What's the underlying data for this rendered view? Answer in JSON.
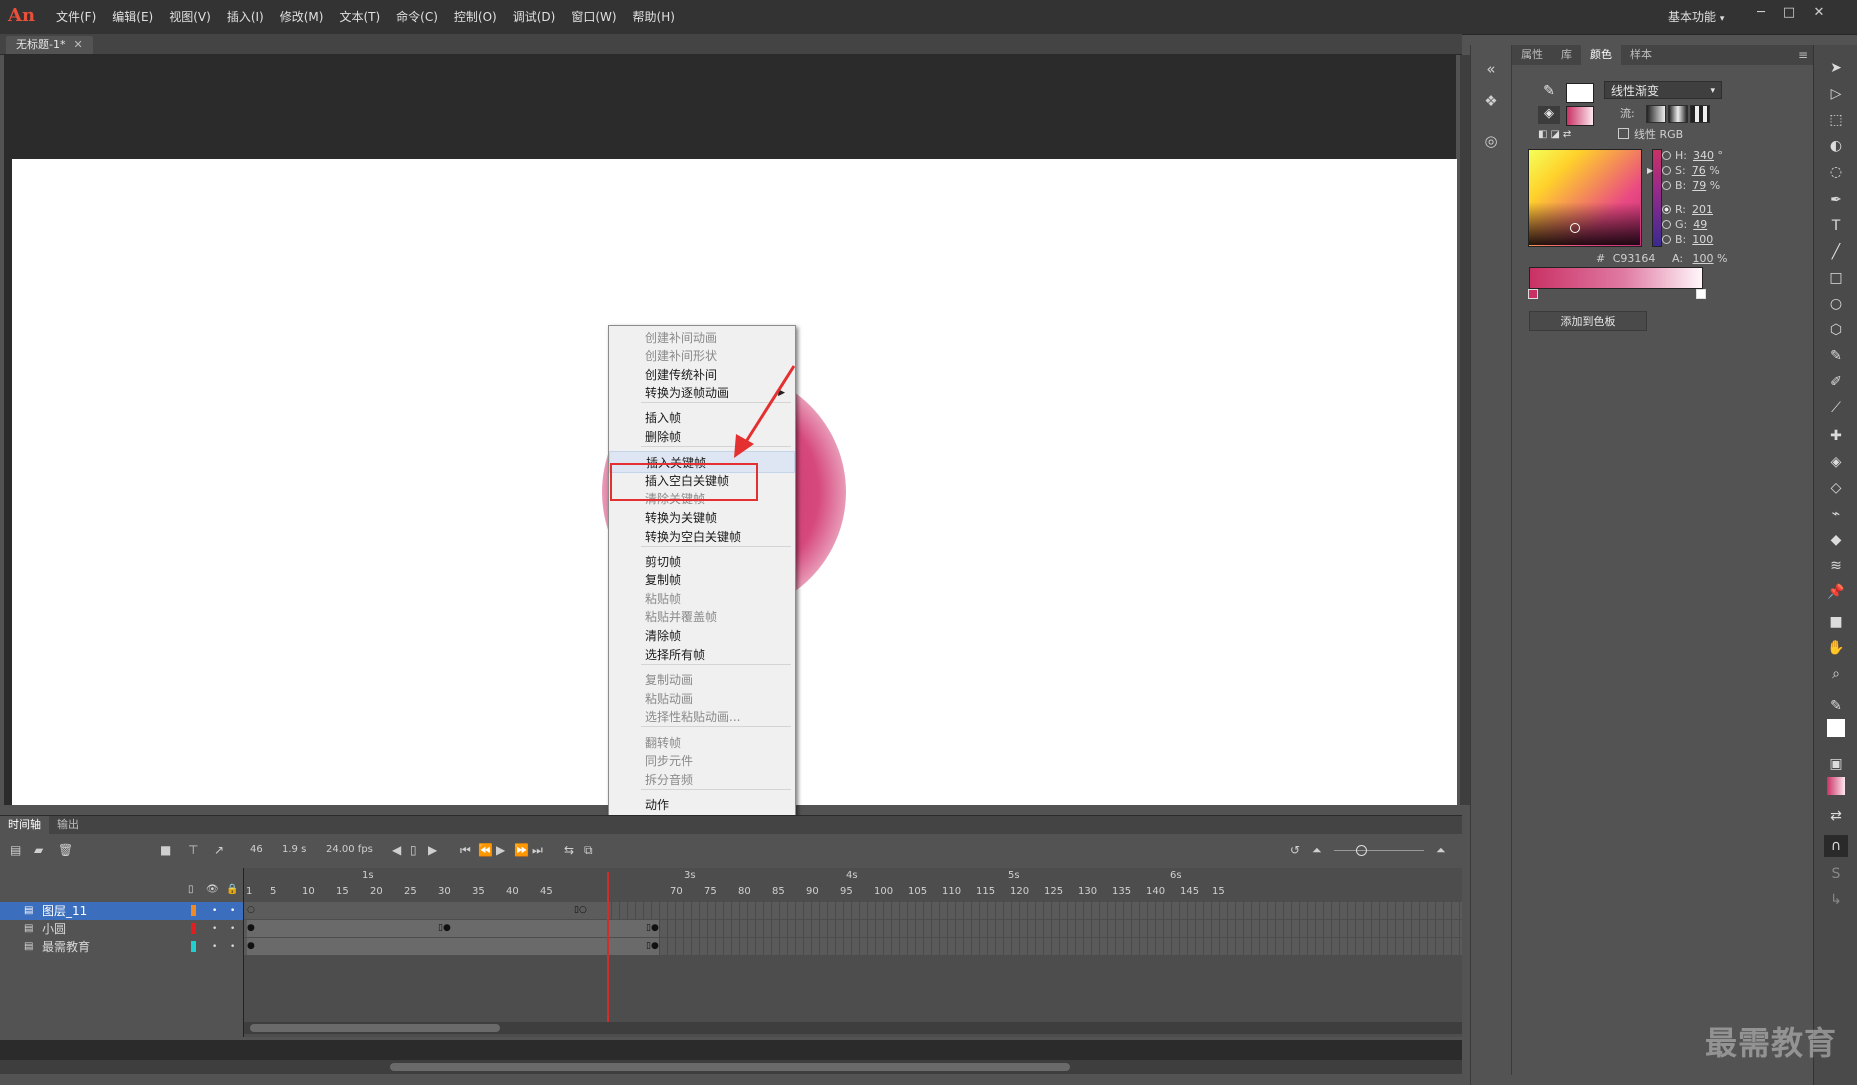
{
  "app": {
    "logo": "An",
    "workspace": "基本功能",
    "window_buttons": [
      "─",
      "□",
      "✕"
    ]
  },
  "menubar": [
    "文件(F)",
    "编辑(E)",
    "视图(V)",
    "插入(I)",
    "修改(M)",
    "文本(T)",
    "命令(C)",
    "控制(O)",
    "调试(D)",
    "窗口(W)",
    "帮助(H)"
  ],
  "document_tab": {
    "title": "无标题-1*",
    "close": "✕"
  },
  "context_menu": {
    "items": [
      {
        "label": "创建补间动画",
        "enabled": false
      },
      {
        "label": "创建补间形状",
        "enabled": false
      },
      {
        "label": "创建传统补间",
        "enabled": true
      },
      {
        "label": "转换为逐帧动画",
        "enabled": true,
        "submenu": true
      },
      {
        "label": "插入帧",
        "enabled": true
      },
      {
        "label": "删除帧",
        "enabled": true
      },
      {
        "label": "插入关键帧",
        "enabled": true,
        "highlighted": true
      },
      {
        "label": "插入空白关键帧",
        "enabled": true
      },
      {
        "label": "清除关键帧",
        "enabled": false
      },
      {
        "label": "转换为关键帧",
        "enabled": true
      },
      {
        "label": "转换为空白关键帧",
        "enabled": true
      },
      {
        "label": "剪切帧",
        "enabled": true
      },
      {
        "label": "复制帧",
        "enabled": true
      },
      {
        "label": "粘贴帧",
        "enabled": false
      },
      {
        "label": "粘贴并覆盖帧",
        "enabled": false
      },
      {
        "label": "清除帧",
        "enabled": true
      },
      {
        "label": "选择所有帧",
        "enabled": true
      },
      {
        "label": "复制动画",
        "enabled": false
      },
      {
        "label": "粘贴动画",
        "enabled": false
      },
      {
        "label": "选择性粘贴动画...",
        "enabled": false
      },
      {
        "label": "翻转帧",
        "enabled": false
      },
      {
        "label": "同步元件",
        "enabled": false
      },
      {
        "label": "拆分音频",
        "enabled": false
      },
      {
        "label": "动作",
        "enabled": true
      }
    ],
    "submenu_arrow": "▶"
  },
  "color_panel": {
    "tabs": [
      "属性",
      "库",
      "颜色",
      "样本"
    ],
    "active_tab": "颜色",
    "gradient_type": "线性渐变",
    "flow_label": "流:",
    "linear_rgb_label": "线性 RGB",
    "hsb": [
      {
        "key": "H:",
        "value": "340",
        "unit": "°"
      },
      {
        "key": "S:",
        "value": "76",
        "unit": "%"
      },
      {
        "key": "B:",
        "value": "79",
        "unit": "%"
      }
    ],
    "rgb": [
      {
        "key": "R:",
        "value": "201"
      },
      {
        "key": "G:",
        "value": "49"
      },
      {
        "key": "B:",
        "value": "100"
      }
    ],
    "hex_label": "#",
    "hex": "C93164",
    "alpha_label": "A:",
    "alpha": "100",
    "alpha_unit": "%",
    "add_to_swatches": "添加到色板",
    "fill_color": "#c93164"
  },
  "timeline": {
    "tabs": [
      "时间轴",
      "输出"
    ],
    "current_frame": "46",
    "elapsed": "1.9 s",
    "fps": "24.00 fps",
    "seconds_ruler": [
      "1s",
      "3s",
      "4s",
      "5s",
      "6s"
    ],
    "frame_ruler": [
      "1",
      "5",
      "10",
      "15",
      "20",
      "25",
      "30",
      "35",
      "40",
      "45",
      "70",
      "75",
      "80",
      "85",
      "90",
      "95",
      "100",
      "105",
      "110",
      "115",
      "120",
      "125",
      "130",
      "135",
      "140",
      "145",
      "15"
    ],
    "layers": [
      {
        "name": "图层_11",
        "color": "#f08a24",
        "selected": true
      },
      {
        "name": "小圆",
        "color": "#e02020",
        "selected": false
      },
      {
        "name": "最需教育",
        "color": "#20d0d0",
        "selected": false
      }
    ]
  },
  "watermark": "最需教育"
}
